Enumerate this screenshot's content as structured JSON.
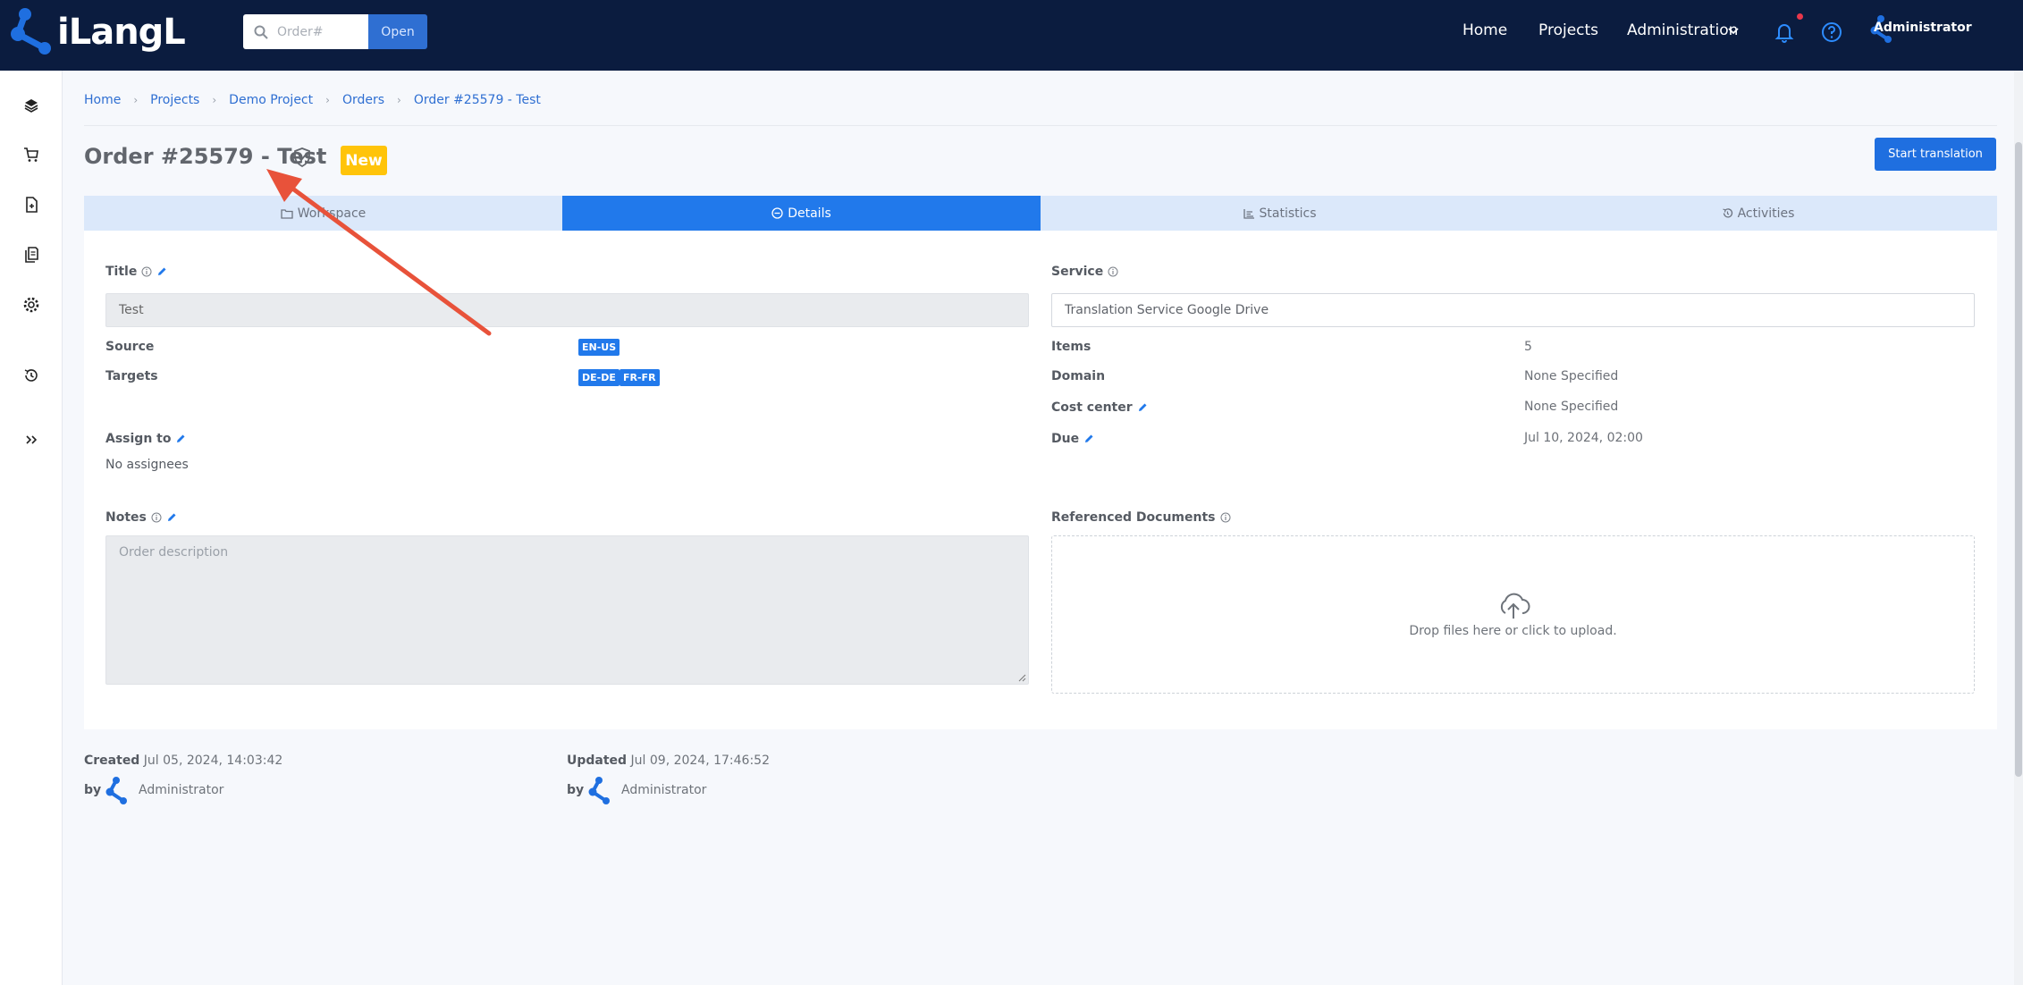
{
  "header": {
    "brand": "iLangL",
    "search_placeholder": "Order#",
    "open_label": "Open",
    "nav": [
      "Home",
      "Projects",
      "Administration"
    ],
    "user": "Administrator",
    "accent_color": "#0b1c3f"
  },
  "sidebar": {
    "icons": [
      "layers-icon",
      "cart-icon",
      "file-plus-icon",
      "documents-icon",
      "gear-icon",
      "history-icon",
      "expand-icon"
    ]
  },
  "breadcrumb": [
    "Home",
    "Projects",
    "Demo Project",
    "Orders",
    "Order #25579 - Test"
  ],
  "page": {
    "title": "Order #25579 - Test",
    "status": "New",
    "start_label": "Start translation"
  },
  "tabs": [
    {
      "label": "Workspace",
      "icon": "folder-icon"
    },
    {
      "label": "Details",
      "icon": "minus-circle-icon"
    },
    {
      "label": "Statistics",
      "icon": "chart-icon"
    },
    {
      "label": "Activities",
      "icon": "history-icon"
    }
  ],
  "details": {
    "title_label": "Title",
    "title_value": "Test",
    "source_label": "Source",
    "source_value": "EN-US",
    "targets_label": "Targets",
    "targets": [
      "DE-DE",
      "FR-FR"
    ],
    "assign_label": "Assign to",
    "assign_value": "No assignees",
    "notes_label": "Notes",
    "notes_placeholder": "Order description",
    "service_label": "Service",
    "service_value": "Translation Service Google Drive",
    "items_label": "Items",
    "items_value": "5",
    "domain_label": "Domain",
    "domain_value": "None Specified",
    "cost_label": "Cost center",
    "cost_value": "None Specified",
    "due_label": "Due",
    "due_value": "Jul 10, 2024, 02:00",
    "refdocs_label": "Referenced Documents",
    "drop_text": "Drop files here or click to upload."
  },
  "meta": {
    "created_label": "Created",
    "created_value": "Jul 05, 2024, 14:03:42",
    "updated_label": "Updated",
    "updated_value": "Jul 09, 2024, 17:46:52",
    "by_label": "by",
    "created_by": "Administrator",
    "updated_by": "Administrator"
  },
  "annotation": {
    "arrow_color": "#e8523a"
  }
}
